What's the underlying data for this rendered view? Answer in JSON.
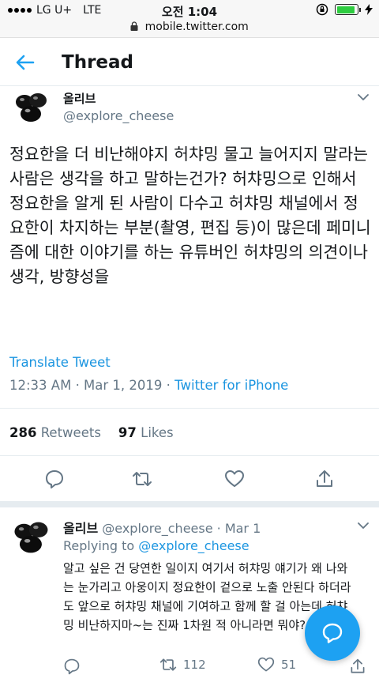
{
  "status_bar": {
    "carrier": "LG U+",
    "network": "LTE",
    "time": "오전 1:04",
    "battery_level": 0.9
  },
  "url_bar": {
    "url": "mobile.twitter.com"
  },
  "header": {
    "title": "Thread"
  },
  "main_tweet": {
    "name": "올리브",
    "handle": "@explore_cheese",
    "text": "정요한을 더 비난해야지 허챠밍 물고 늘어지지 말라는 사람은 생각을 하고 말하는건가? 허챠밍으로 인해서 정요한을 알게 된 사람이 다수고 허챠밍 채널에서 정요한이 차지하는 부분(촬영, 편집 등)이 많은데 페미니즘에 대한 이야기를 하는 유튜버인 허챠밍의 의견이나 생각, 방향성을",
    "translate_label": "Translate Tweet",
    "timestamp": "12:33 AM · Mar 1, 2019 · ",
    "source": "Twitter for iPhone",
    "retweets_count": "286",
    "retweets_label": "Retweets",
    "likes_count": "97",
    "likes_label": "Likes"
  },
  "reply_tweet": {
    "name": "올리브",
    "handle_date": "@explore_cheese · Mar 1",
    "replying_label": "Replying to ",
    "replying_to": "@explore_cheese",
    "text": "알고 싶은 건 당연한 일이지 여기서 허챠밍 얘기가 왜 나와는 눈가리고 아웅이지 정요한이 겉으로 노출 안된다 하더라도 앞으로 허챠밍 채널에 기여하고 함께 할 걸 아는데 허챠밍 비난하지마~는 진짜 1차원 적 아니라면 뭐야?",
    "retweet_count": "112",
    "like_count": "51"
  },
  "icons": {
    "back": "back-arrow-icon",
    "reply": "reply-icon",
    "retweet": "retweet-icon",
    "like": "heart-icon",
    "share": "share-icon",
    "compose": "compose-icon"
  },
  "colors": {
    "accent": "#1da1f2",
    "link": "#1b95e0",
    "secondary_text": "#657786",
    "primary_text": "#14171a"
  }
}
